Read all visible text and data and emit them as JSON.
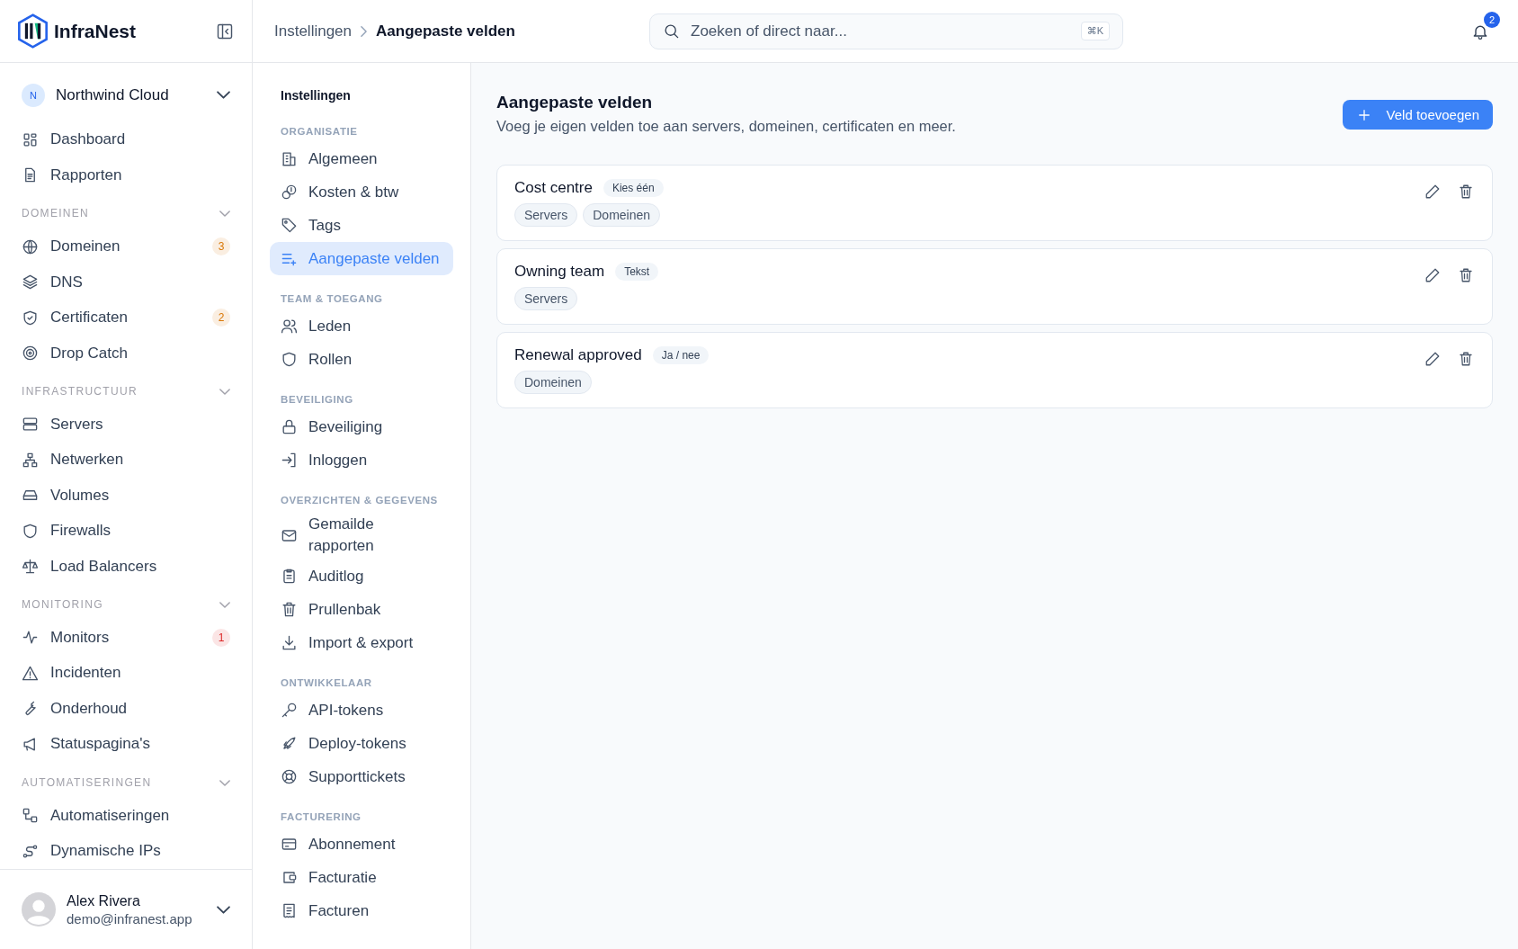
{
  "brand": {
    "name": "InfraNest"
  },
  "workspace": {
    "initial": "N",
    "name": "Northwind Cloud"
  },
  "sidebar": {
    "top_items": [
      {
        "label": "Dashboard"
      },
      {
        "label": "Rapporten"
      }
    ],
    "sections": [
      {
        "title": "DOMEINEN",
        "expanded": true,
        "items": [
          {
            "label": "Domeinen",
            "badge": {
              "text": "3",
              "color": "#d97706"
            }
          },
          {
            "label": "DNS"
          },
          {
            "label": "Certificaten",
            "badge": {
              "text": "2",
              "color": "#d97706"
            }
          },
          {
            "label": "Drop Catch"
          }
        ]
      },
      {
        "title": "INFRASTRUCTUUR",
        "expanded": true,
        "items": [
          {
            "label": "Servers"
          },
          {
            "label": "Netwerken"
          },
          {
            "label": "Volumes"
          },
          {
            "label": "Firewalls"
          },
          {
            "label": "Load Balancers"
          }
        ]
      },
      {
        "title": "MONITORING",
        "expanded": true,
        "items": [
          {
            "label": "Monitors",
            "badge": {
              "text": "1",
              "color": "#dc2626"
            }
          },
          {
            "label": "Incidenten"
          },
          {
            "label": "Onderhoud"
          },
          {
            "label": "Statuspagina's"
          }
        ]
      },
      {
        "title": "AUTOMATISERINGEN",
        "expanded": true,
        "items": [
          {
            "label": "Automatiseringen"
          },
          {
            "label": "Dynamische IPs"
          }
        ]
      }
    ]
  },
  "user": {
    "name": "Alex Rivera",
    "email": "demo@infranest.app"
  },
  "breadcrumb": [
    {
      "label": "Instellingen",
      "current": false
    },
    {
      "label": "Aangepaste velden",
      "current": true
    }
  ],
  "search": {
    "placeholder": "Zoeken of direct naar...",
    "shortcut": "⌘K"
  },
  "notifications": {
    "count": "2"
  },
  "settings_nav": {
    "title": "Instellingen",
    "groups": [
      {
        "title": "ORGANISATIE",
        "items": [
          {
            "label": "Algemeen",
            "selected": false
          },
          {
            "label": "Kosten & btw",
            "selected": false
          },
          {
            "label": "Tags",
            "selected": false
          },
          {
            "label": "Aangepaste velden",
            "selected": true
          }
        ]
      },
      {
        "title": "TEAM & TOEGANG",
        "items": [
          {
            "label": "Leden",
            "selected": false
          },
          {
            "label": "Rollen",
            "selected": false
          }
        ]
      },
      {
        "title": "BEVEILIGING",
        "items": [
          {
            "label": "Beveiliging",
            "selected": false
          },
          {
            "label": "Inloggen",
            "selected": false
          }
        ]
      },
      {
        "title": "OVERZICHTEN & GEGEVENS",
        "items": [
          {
            "label": "Gemailde rapporten",
            "selected": false
          },
          {
            "label": "Auditlog",
            "selected": false
          },
          {
            "label": "Prullenbak",
            "selected": false
          },
          {
            "label": "Import & export",
            "selected": false
          }
        ]
      },
      {
        "title": "ONTWIKKELAAR",
        "items": [
          {
            "label": "API-tokens",
            "selected": false
          },
          {
            "label": "Deploy-tokens",
            "selected": false
          },
          {
            "label": "Supporttickets",
            "selected": false
          }
        ]
      },
      {
        "title": "FACTURERING",
        "items": [
          {
            "label": "Abonnement",
            "selected": false
          },
          {
            "label": "Facturatie",
            "selected": false
          },
          {
            "label": "Facturen",
            "selected": false
          }
        ]
      }
    ]
  },
  "page": {
    "title": "Aangepaste velden",
    "subtitle": "Voeg je eigen velden toe aan servers, domeinen, certificaten en meer.",
    "add_button": "Veld toevoegen"
  },
  "fields": [
    {
      "name": "Cost centre",
      "type": "Kies één",
      "applies_to": [
        "Servers",
        "Domeinen"
      ]
    },
    {
      "name": "Owning team",
      "type": "Tekst",
      "applies_to": [
        "Servers"
      ]
    },
    {
      "name": "Renewal approved",
      "type": "Ja / nee",
      "applies_to": [
        "Domeinen"
      ]
    }
  ]
}
